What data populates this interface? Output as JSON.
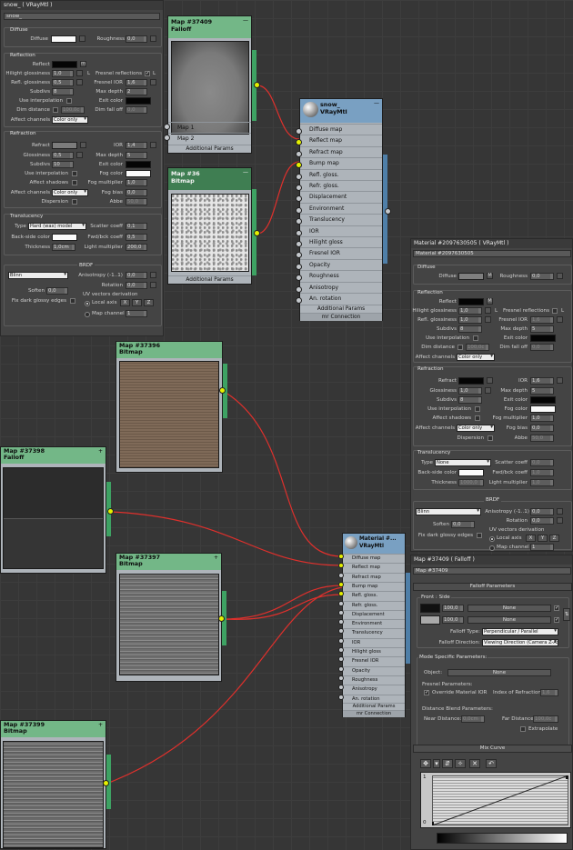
{
  "colors": {
    "wire": "#e0302c",
    "node_green": "#73b787",
    "node_dark_green": "#3f7e52",
    "node_blue": "#79a0c2",
    "socket_active": "#e5f000"
  },
  "top_material_panel": {
    "title": "snow_  ( VRayMtl )",
    "name_field": "snow_",
    "diffuse": {
      "group": "Diffuse",
      "diffuse_label": "Diffuse",
      "roughness_label": "Roughness",
      "roughness_value": "0,0"
    },
    "reflection": {
      "group": "Reflection",
      "reflect": "Reflect",
      "m": "m",
      "hilight_glossiness": "Hilight glossiness",
      "hilight_value": "1,0",
      "l": "L",
      "fresnel_reflections": "Fresnel reflections",
      "refl_glossiness": "Refl. glossiness",
      "refl_value": "0,5",
      "fresnel_ior": "Fresnel IOR",
      "fresnel_value": "1,6",
      "subdivs": "Subdivs",
      "subdivs_value": "8",
      "max_depth": "Max depth",
      "max_depth_value": "2",
      "use_interpolation": "Use interpolation",
      "exit_color": "Exit color",
      "dim_distance": "Dim distance",
      "dim_value": "100,0c",
      "dim_fall_off": "Dim fall off",
      "dim_fall_value": "0,0",
      "affect_channels": "Affect channels",
      "affect_value": "Color only"
    },
    "refraction": {
      "group": "Refraction",
      "refract": "Refract",
      "ior": "IOR",
      "ior_value": "1,4",
      "glossiness": "Glossiness",
      "glossiness_value": "0,5",
      "max_depth": "Max depth",
      "max_depth_value": "5",
      "subdivs": "Subdivs",
      "subdivs_value": "10",
      "exit_color": "Exit color",
      "use_interpolation": "Use interpolation",
      "fog_color": "Fog color",
      "affect_shadows": "Affect shadows",
      "fog_multiplier": "Fog multiplier",
      "fog_multiplier_value": "1,0",
      "affect_channels": "Affect channels",
      "affect_value": "Color only",
      "fog_bias": "Fog bias",
      "fog_bias_value": "0,0",
      "dispersion": "Dispersion",
      "abbe": "Abbe",
      "abbe_value": "50,0"
    },
    "translucency": {
      "group": "Translucency",
      "type": "Type",
      "type_value": "Hard (wax) model",
      "scatter_coeff": "Scatter coeff",
      "scatter_value": "0,1",
      "back_side_color": "Back-side color",
      "fwd_bck_coeff": "Fwd/bck coeff",
      "fwd_value": "0,5",
      "thickness": "Thickness",
      "thickness_value": "1,0cm",
      "light_multiplier": "Light multiplier",
      "light_value": "200,0"
    },
    "brdf": {
      "group": "BRDF",
      "type_value": "Blinn",
      "anisotropy": "Anisotropy (-1..1)",
      "anisotropy_value": "0,0",
      "rotation": "Rotation",
      "rotation_value": "0,0",
      "soften": "Soften",
      "soften_value": "0,0",
      "fix_dark": "Fix dark glossy edges",
      "uv_vectors": "UV vectors derivation",
      "local_axis": "Local axis",
      "x": "X",
      "y": "Y",
      "z": "Z",
      "map_channel": "Map channel",
      "map_channel_value": "1"
    }
  },
  "nodes": {
    "falloff_top": {
      "title": "Map #37409",
      "subtitle": "Falloff",
      "slots": [
        "Map 1",
        "Map 2"
      ],
      "footer": "Additional Params"
    },
    "bitmap_36": {
      "title": "Map #36",
      "subtitle": "Bitmap",
      "footer": "Additional Params"
    },
    "snow_mtl": {
      "title": "snow_",
      "subtitle": "VRayMtl",
      "slots": [
        "Diffuse map",
        "Reflect map",
        "Refract map",
        "Bump map",
        "Refl. gloss.",
        "Refr. gloss.",
        "Displacement",
        "Environment",
        "Translucency",
        "IOR",
        "Hilight gloss",
        "Fresnel IOR",
        "Opacity",
        "Roughness",
        "Anisotropy",
        "An. rotation"
      ],
      "footer1": "Additional Params",
      "footer2": "mr Connection"
    },
    "bitmap_37396": {
      "title": "Map #37396",
      "subtitle": "Bitmap"
    },
    "falloff_37398": {
      "title": "Map #37398",
      "subtitle": "Falloff"
    },
    "bitmap_37397": {
      "title": "Map #37397",
      "subtitle": "Bitmap"
    },
    "bitmap_37399": {
      "title": "Map #37399",
      "subtitle": "Bitmap"
    },
    "material_2": {
      "title": "Material #...",
      "subtitle": "VRayMtl",
      "slots": [
        "Diffuse map",
        "Reflect map",
        "Refract map",
        "Bump map",
        "Refl. gloss.",
        "Refr. gloss.",
        "Displacement",
        "Environment",
        "Translucency",
        "IOR",
        "Hilight gloss",
        "Fresnel IOR",
        "Opacity",
        "Roughness",
        "Anisotropy",
        "An. rotation"
      ],
      "footer1": "Additional Params",
      "footer2": "mr Connection"
    }
  },
  "right_material_panel": {
    "title": "Material #2097630505  ( VRayMtl )",
    "name_field": "Material #2097630505",
    "diffuse": {
      "group": "Diffuse",
      "diffuse_label": "Diffuse",
      "m": "M",
      "roughness_label": "Roughness",
      "roughness_value": "0,0"
    },
    "reflection": {
      "group": "Reflection",
      "reflect": "Reflect",
      "m": "M",
      "hilight_glossiness": "Hilight glossiness",
      "hilight_value": "1,0",
      "l": "L",
      "fresnel_reflections": "Fresnel reflections",
      "refl_glossiness": "Refl. glossiness",
      "refl_value": "1,0",
      "fresnel_ior": "Fresnel IOR",
      "fresnel_value": "1,6",
      "subdivs": "Subdivs",
      "subdivs_value": "8",
      "max_depth": "Max depth",
      "max_depth_value": "5",
      "use_interpolation": "Use interpolation",
      "exit_color": "Exit color",
      "dim_distance": "Dim distance",
      "dim_value": "100,0c",
      "dim_fall_off": "Dim fall off",
      "dim_fall_value": "0,0",
      "affect_channels": "Affect channels",
      "affect_value": "Color only"
    },
    "refraction": {
      "group": "Refraction",
      "refract": "Refract",
      "ior": "IOR",
      "ior_value": "1,6",
      "glossiness": "Glossiness",
      "glossiness_value": "1,0",
      "max_depth": "Max depth",
      "max_depth_value": "5",
      "subdivs": "Subdivs",
      "subdivs_value": "8",
      "exit_color": "Exit color",
      "use_interpolation": "Use interpolation",
      "fog_color": "Fog color",
      "affect_shadows": "Affect shadows",
      "fog_multiplier": "Fog multiplier",
      "fog_multiplier_value": "1,0",
      "affect_channels": "Affect channels",
      "affect_value": "Color only",
      "fog_bias": "Fog bias",
      "fog_bias_value": "0,0",
      "dispersion": "Dispersion",
      "abbe": "Abbe",
      "abbe_value": "50,0"
    },
    "translucency": {
      "group": "Translucency",
      "type": "Type",
      "type_value": "None",
      "scatter_coeff": "Scatter coeff",
      "scatter_value": "0,0",
      "back_side_color": "Back-side color",
      "fwd_bck_coeff": "Fwd/bck coeff",
      "fwd_value": "1,0",
      "thickness": "Thickness",
      "thickness_value": "1000,0",
      "light_multiplier": "Light multiplier",
      "light_value": "1,0"
    },
    "brdf": {
      "group": "BRDF",
      "type_value": "Blinn",
      "anisotropy": "Anisotropy (-1..1)",
      "anisotropy_value": "0,0",
      "rotation": "Rotation",
      "rotation_value": "0,0",
      "soften": "Soften",
      "soften_value": "0,0",
      "fix_dark": "Fix dark glossy edges",
      "uv_vectors": "UV vectors derivation",
      "local_axis": "Local axis",
      "x": "X",
      "y": "Y",
      "z": "Z",
      "map_channel": "Map channel",
      "map_channel_value": "1"
    }
  },
  "falloff_panel": {
    "title": "Map #37409  ( Falloff )",
    "name_field": "Map #37409",
    "params_header": "Falloff Parameters",
    "front_side": "Front : Side",
    "row1_value": "100,0",
    "row2_value": "100,0",
    "none": "None",
    "falloff_type_label": "Falloff Type:",
    "falloff_type_value": "Perpendicular / Parallel",
    "falloff_direction_label": "Falloff Direction:",
    "falloff_direction_value": "Viewing Direction (Camera Z-Axis)",
    "mode_specific": "Mode Specific Parameters:",
    "object_label": "Object:",
    "fresnel_params": "Fresnel Parameters:",
    "override_ior": "Override Material IOR",
    "index_of_refraction": "Index of Refraction",
    "ior_value": "1,6",
    "distance_blend": "Distance Blend Parameters:",
    "near_distance": "Near Distance:",
    "near_value": "0,0cm",
    "far_distance": "Far Distance:",
    "far_value": "100,0c",
    "extrapolate": "Extrapolate",
    "mix_curve": "Mix Curve",
    "curve_axis_top": "1",
    "curve_axis_bottom": "0"
  }
}
